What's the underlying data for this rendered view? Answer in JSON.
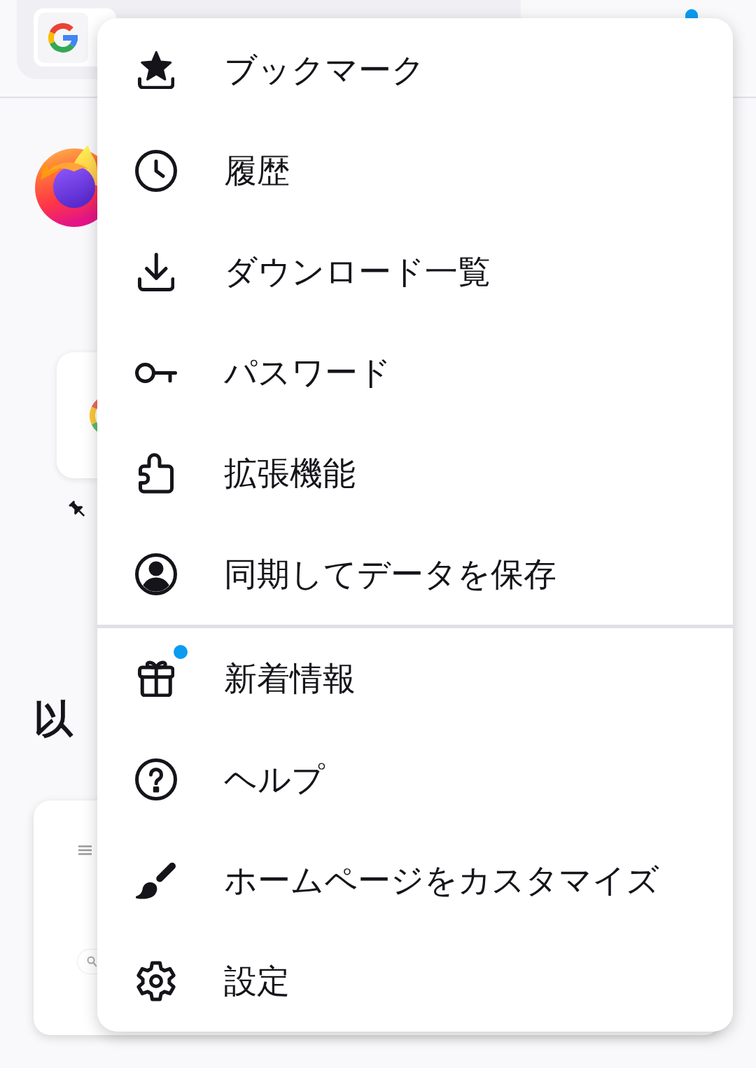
{
  "toolbar": {
    "menu_badge": true
  },
  "home": {
    "heading": "以"
  },
  "menu": {
    "sections": [
      {
        "items": [
          {
            "label": "ブックマーク",
            "badge": false
          },
          {
            "label": "履歴",
            "badge": false
          },
          {
            "label": "ダウンロード一覧",
            "badge": false
          },
          {
            "label": "パスワード",
            "badge": false
          },
          {
            "label": "拡張機能",
            "badge": false
          },
          {
            "label": "同期してデータを保存",
            "badge": false
          }
        ]
      },
      {
        "items": [
          {
            "label": "新着情報",
            "badge": true
          },
          {
            "label": "ヘルプ",
            "badge": false
          },
          {
            "label": "ホームページをカスタマイズ",
            "badge": false
          },
          {
            "label": "設定",
            "badge": false
          }
        ]
      }
    ]
  }
}
